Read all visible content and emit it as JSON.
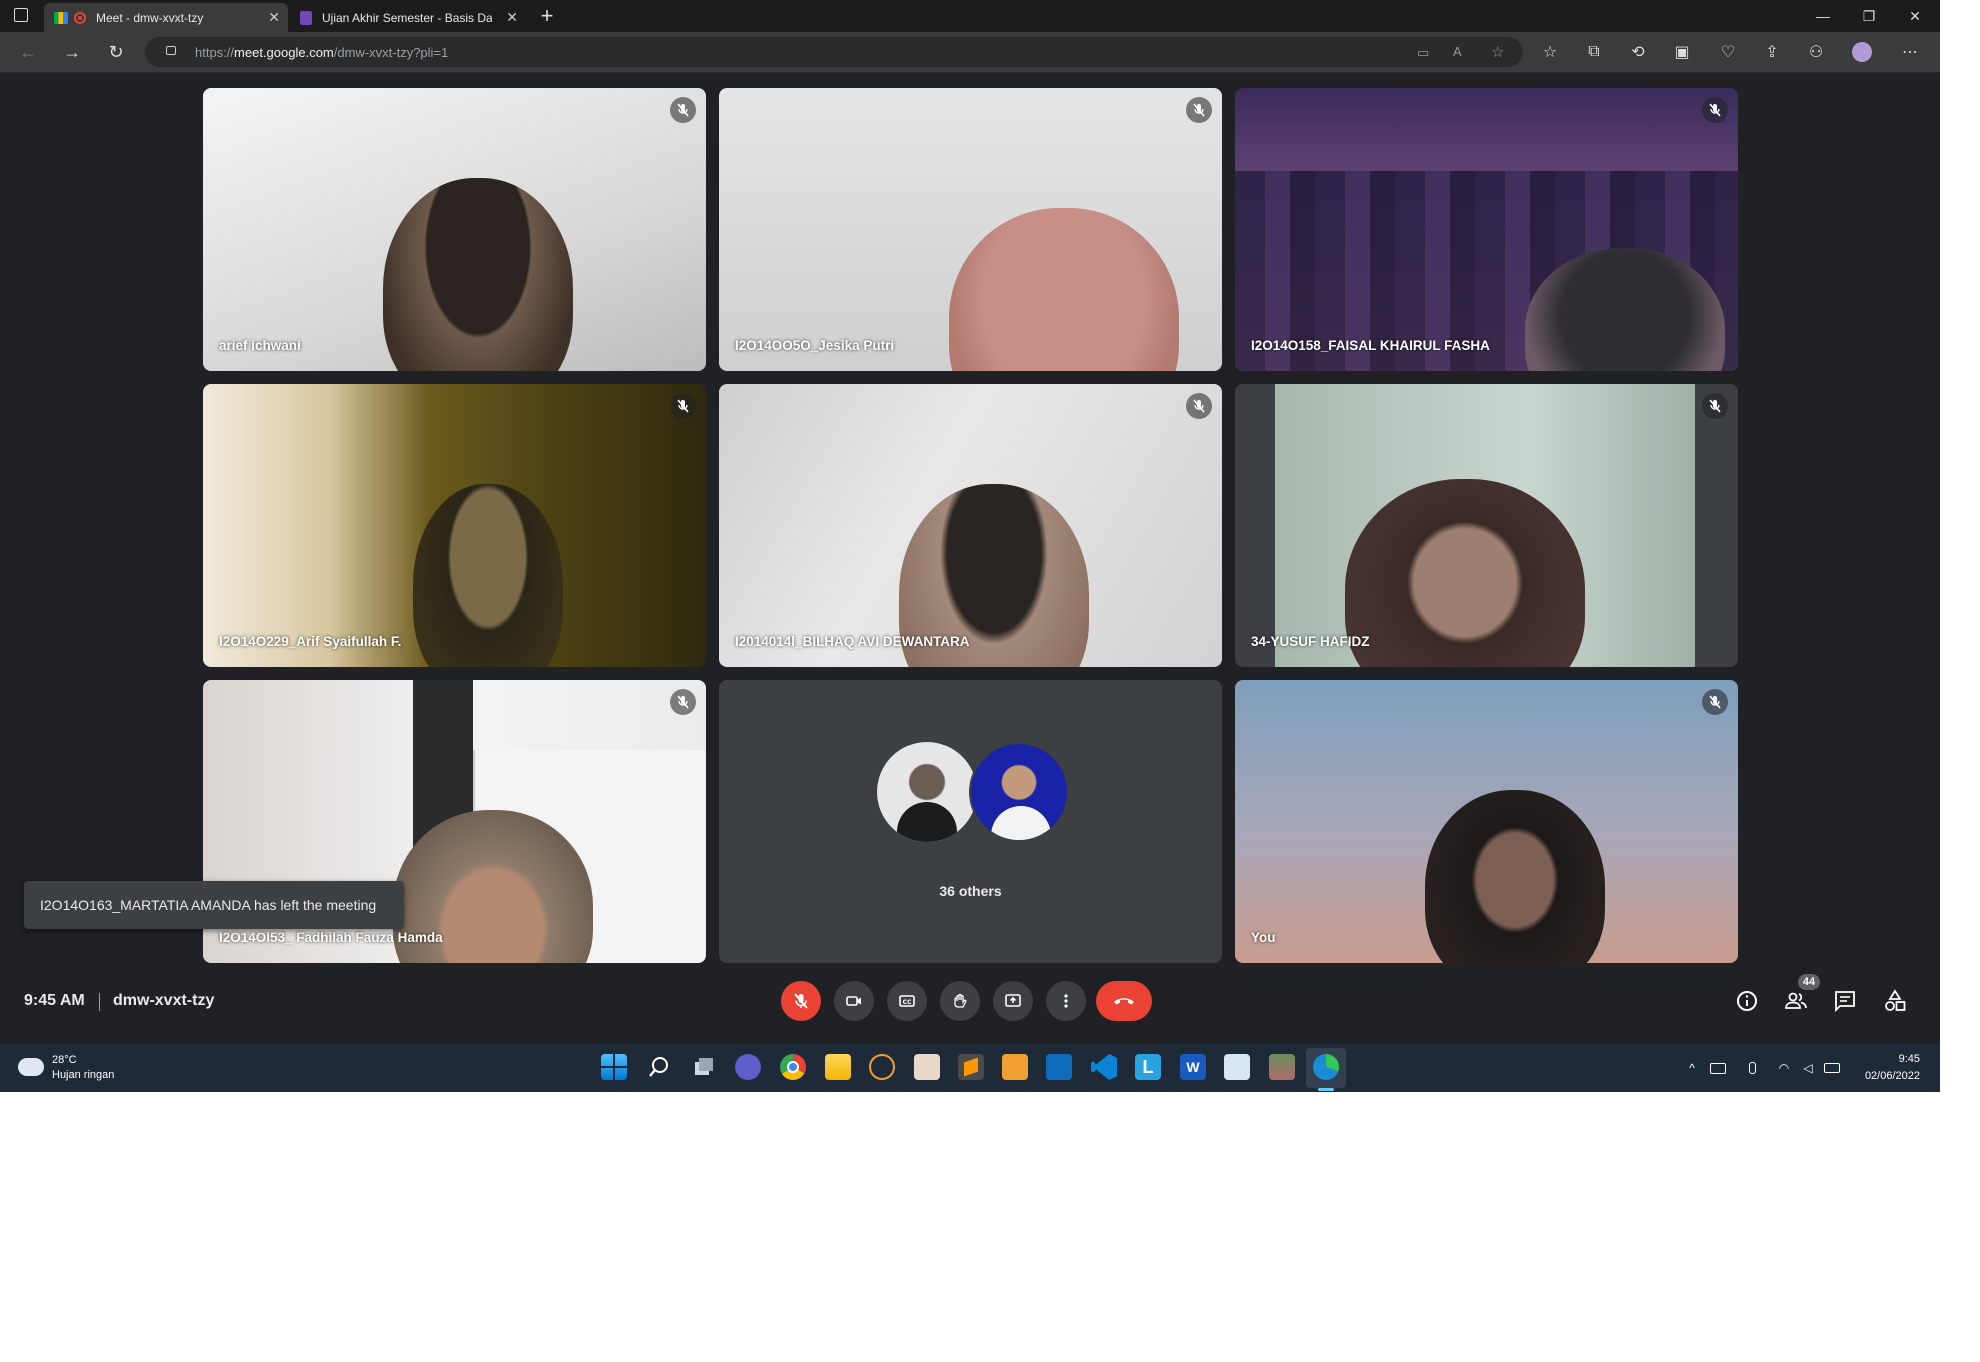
{
  "browser": {
    "tabs": [
      {
        "title": "Meet - dmw-xvxt-tzy",
        "active": true
      },
      {
        "title": "Ujian Akhir Semester - Basis Dat",
        "active": false
      }
    ],
    "url_prefix": "https://",
    "url_domain": "meet.google.com",
    "url_path": "/dmw-xvxt-tzy?pli=1"
  },
  "tiles": [
    {
      "name": "arief ichwani",
      "muted": true
    },
    {
      "name": "I2O14OO5O_Jesika Putri",
      "muted": true
    },
    {
      "name": "I2O14O158_FAISAL KHAIRUL FASHA",
      "muted": true
    },
    {
      "name": "I2O14O229_Arif Syaifullah F.",
      "muted": true
    },
    {
      "name": "I2014014l_BILHAQ AVI DEWANTARA",
      "muted": true
    },
    {
      "name": "34-YUSUF HAFIDZ",
      "muted": true
    },
    {
      "name": "I2O14Ol53_ Fadhilah Fauza Hamda",
      "muted": true
    },
    {
      "name": "36 others",
      "muted": false
    },
    {
      "name": "You",
      "muted": true
    }
  ],
  "toast": "I2O14O163_MARTATIA AMANDA has left the meeting",
  "meeting": {
    "time": "9:45 AM",
    "code": "dmw-xvxt-tzy",
    "participants_count": "44"
  },
  "controls": [
    "mic-muted",
    "camera",
    "captions",
    "raise-hand",
    "present",
    "more-options",
    "leave-call"
  ],
  "side_controls": [
    "meeting-details",
    "people",
    "chat",
    "activities"
  ],
  "taskbar": {
    "weather_temp": "28°C",
    "weather_desc": "Hujan ringan",
    "time": "9:45",
    "date": "02/06/2022"
  },
  "colors": {
    "meet_bg": "#202124",
    "tile_bg": "#3c4043",
    "danger": "#ea4335",
    "taskbar": "#1f2a38"
  }
}
